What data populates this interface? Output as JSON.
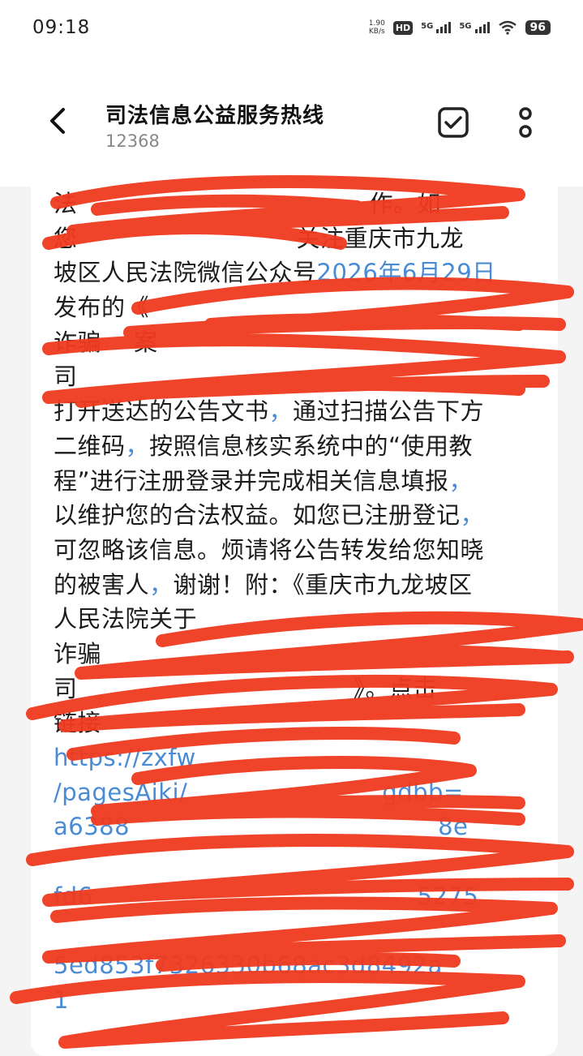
{
  "status_bar": {
    "time": "09:18",
    "net_speed_value": "1.90",
    "net_speed_unit": "KB/s",
    "hd_label": "HD",
    "sim1_label": "5G",
    "sim2_label": "5G",
    "battery": "96"
  },
  "header": {
    "contact_name": "司法信息公益服务热线",
    "contact_number": "12368"
  },
  "message": {
    "lines": [
      "法",
      "您",
      "坡区人民法院微信公众号",
      "发布的《",
      "诈骗",
      "司",
      "打开送达的公告文书",
      "二维码",
      "程”进行注册登录并完成相关信息填报",
      "以维护您的合法权益。如您已注册登记",
      "可忽略该信息。烦请将公告转发给您知晓",
      "的被害人",
      "人民法院关于",
      "诈骗",
      "司",
      "链接",
      "https://zxfw",
      "/pagesAiki/",
      "a6388",
      "",
      "fd6",
      "",
      "5ed853f",
      "1"
    ],
    "fragments": {
      "line0_tail": "作。如",
      "line1_tail": "关注重庆市九龙",
      "date": "2026年6月29日",
      "line4_tail": "案",
      "line6_tail": "通过扫描公告下方",
      "line7_tail": "按照信息核实系统中的“使用教",
      "line11_tail": "谢谢！附：《重庆市九龙坡区",
      "line14_tail": "》。点击",
      "line17_tail": "gdbb=",
      "line18_tail": "8e",
      "line20_tail": "5275",
      "line22_tail": "7326330b68ac3d8492a"
    }
  }
}
